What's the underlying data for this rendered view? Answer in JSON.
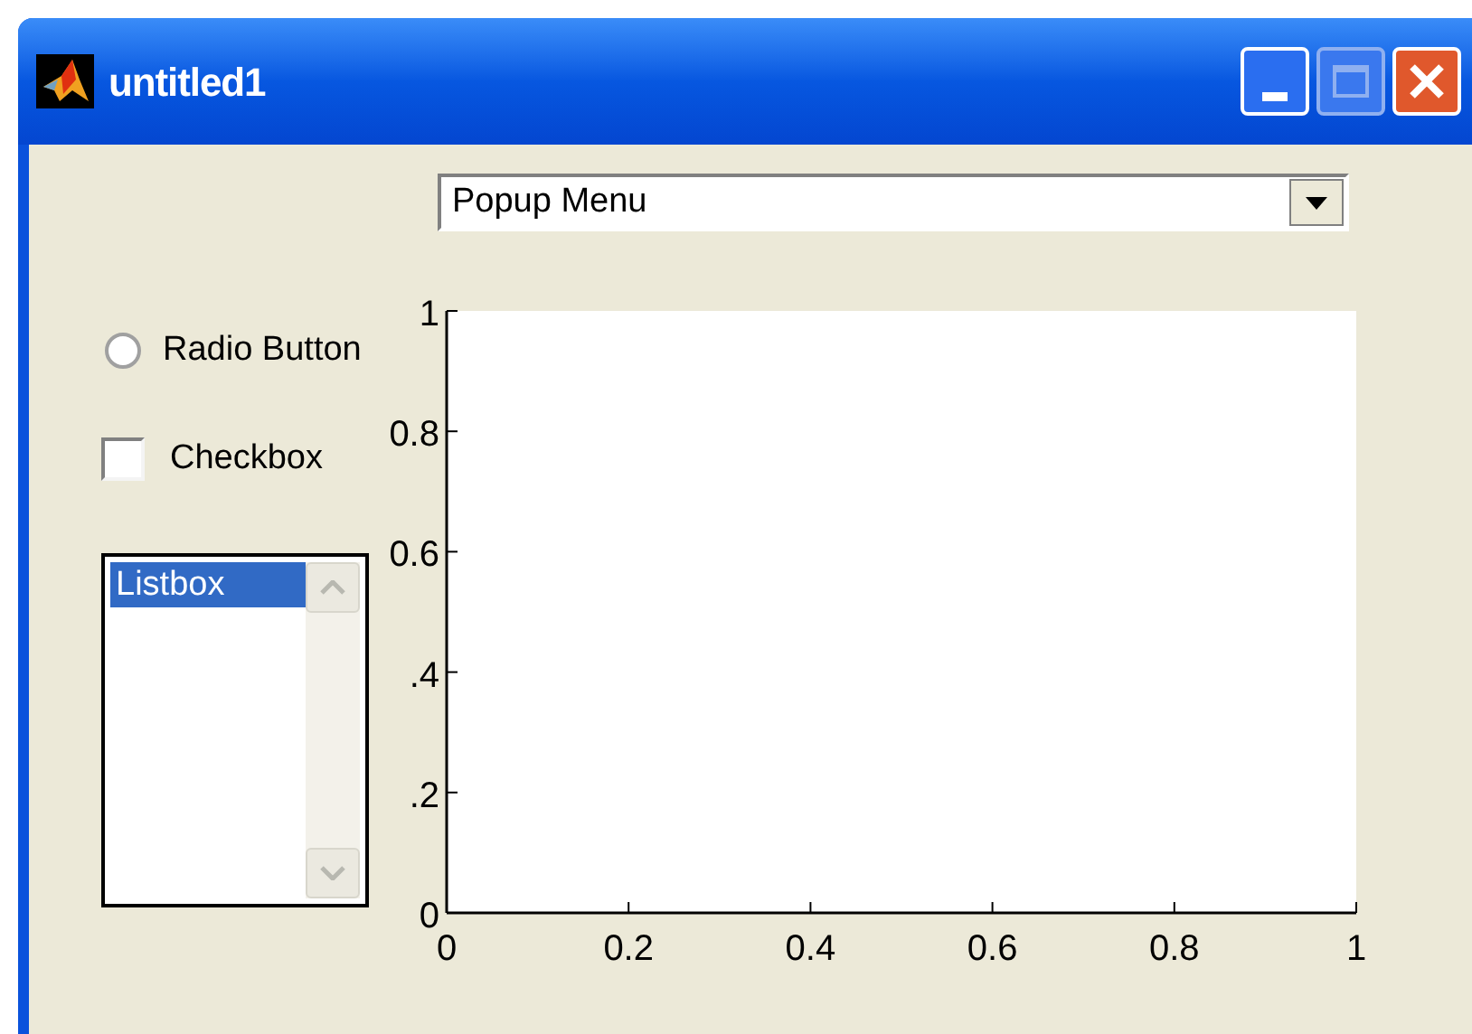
{
  "window": {
    "title": "untitled1"
  },
  "popup_menu": {
    "value": "Popup Menu"
  },
  "radio_button": {
    "label": "Radio Button",
    "selected": false
  },
  "checkbox": {
    "label": "Checkbox",
    "checked": false
  },
  "listbox": {
    "items": [
      {
        "label": "Listbox",
        "selected": true
      }
    ]
  },
  "axes": {
    "chart_data": {
      "type": "line",
      "xlim": [
        0,
        1
      ],
      "ylim": [
        0,
        1
      ],
      "xticks": [
        {
          "value": 0,
          "label": "0"
        },
        {
          "value": 0.2,
          "label": "0.2"
        },
        {
          "value": 0.4,
          "label": "0.4"
        },
        {
          "value": 0.6,
          "label": "0.6"
        },
        {
          "value": 0.8,
          "label": "0.8"
        },
        {
          "value": 1,
          "label": "1"
        }
      ],
      "yticks": [
        {
          "value": 0,
          "label": "0"
        },
        {
          "value": 0.2,
          "label": ".2"
        },
        {
          "value": 0.4,
          "label": ".4"
        },
        {
          "value": 0.6,
          "label": "0.6"
        },
        {
          "value": 0.8,
          "label": "0.8"
        },
        {
          "value": 1,
          "label": "1"
        }
      ]
    }
  }
}
